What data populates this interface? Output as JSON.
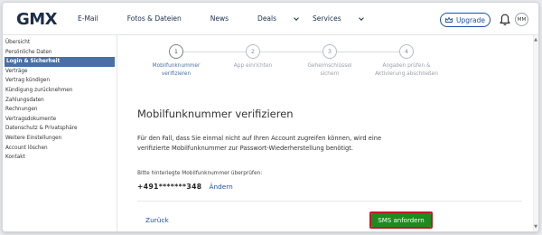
{
  "header": {
    "logo": "GMX",
    "nav": [
      {
        "label": "E-Mail",
        "dropdown": false
      },
      {
        "label": "Fotos & Dateien",
        "dropdown": false
      },
      {
        "label": "News",
        "dropdown": false
      },
      {
        "label": "Deals",
        "dropdown": true
      },
      {
        "label": "Services",
        "dropdown": true
      }
    ],
    "upgrade_label": "Upgrade",
    "avatar_initials": "MM",
    "icons": {
      "upgrade": "crown-icon",
      "notifications": "bell-icon"
    }
  },
  "sidebar": {
    "items": [
      {
        "label": "Übersicht",
        "active": false
      },
      {
        "label": "Persönliche Daten",
        "active": false
      },
      {
        "label": "Login & Sicherheit",
        "active": true
      },
      {
        "label": "Verträge",
        "active": false
      },
      {
        "label": "Vertrag kündigen",
        "active": false
      },
      {
        "label": "Kündigung zurücknehmen",
        "active": false
      },
      {
        "label": "Zahlungsdaten",
        "active": false
      },
      {
        "label": "Rechnungen",
        "active": false
      },
      {
        "label": "Vertragsdokumente",
        "active": false
      },
      {
        "label": "Datenschutz & Privatsphäre",
        "active": false
      },
      {
        "label": "Weitere Einstellungen",
        "active": false
      },
      {
        "label": "Account löschen",
        "active": false
      },
      {
        "label": "Kontakt",
        "active": false
      }
    ]
  },
  "steps": [
    {
      "number": "1",
      "label": "Mobilfunknummer verifizieren",
      "current": true
    },
    {
      "number": "2",
      "label": "App einrichten",
      "current": false
    },
    {
      "number": "3",
      "label": "Geheimschlüssel sichern",
      "current": false
    },
    {
      "number": "4",
      "label": "Angaben prüfen & Aktivierung abschließen",
      "current": false
    }
  ],
  "main": {
    "title": "Mobilfunknummer verifizieren",
    "description": "Für den Fall, dass Sie einmal nicht auf Ihren Account zugreifen können, wird eine verifizierte Mobilfunknummer zur Passwort-Wiederherstellung benötigt.",
    "hint": "Bitte hinterlegte Mobilfunknummer überprüfen:",
    "phone": "+491*******348",
    "change_label": "Ändern",
    "back_label": "Zurück",
    "sms_label": "SMS anfordern"
  },
  "colors": {
    "brand": "#1c2e4a",
    "accent": "#1e4fa8",
    "active_sidebar": "#4a6fa5",
    "primary_button": "#1d8b1d",
    "highlight_outline": "#c0182a"
  }
}
